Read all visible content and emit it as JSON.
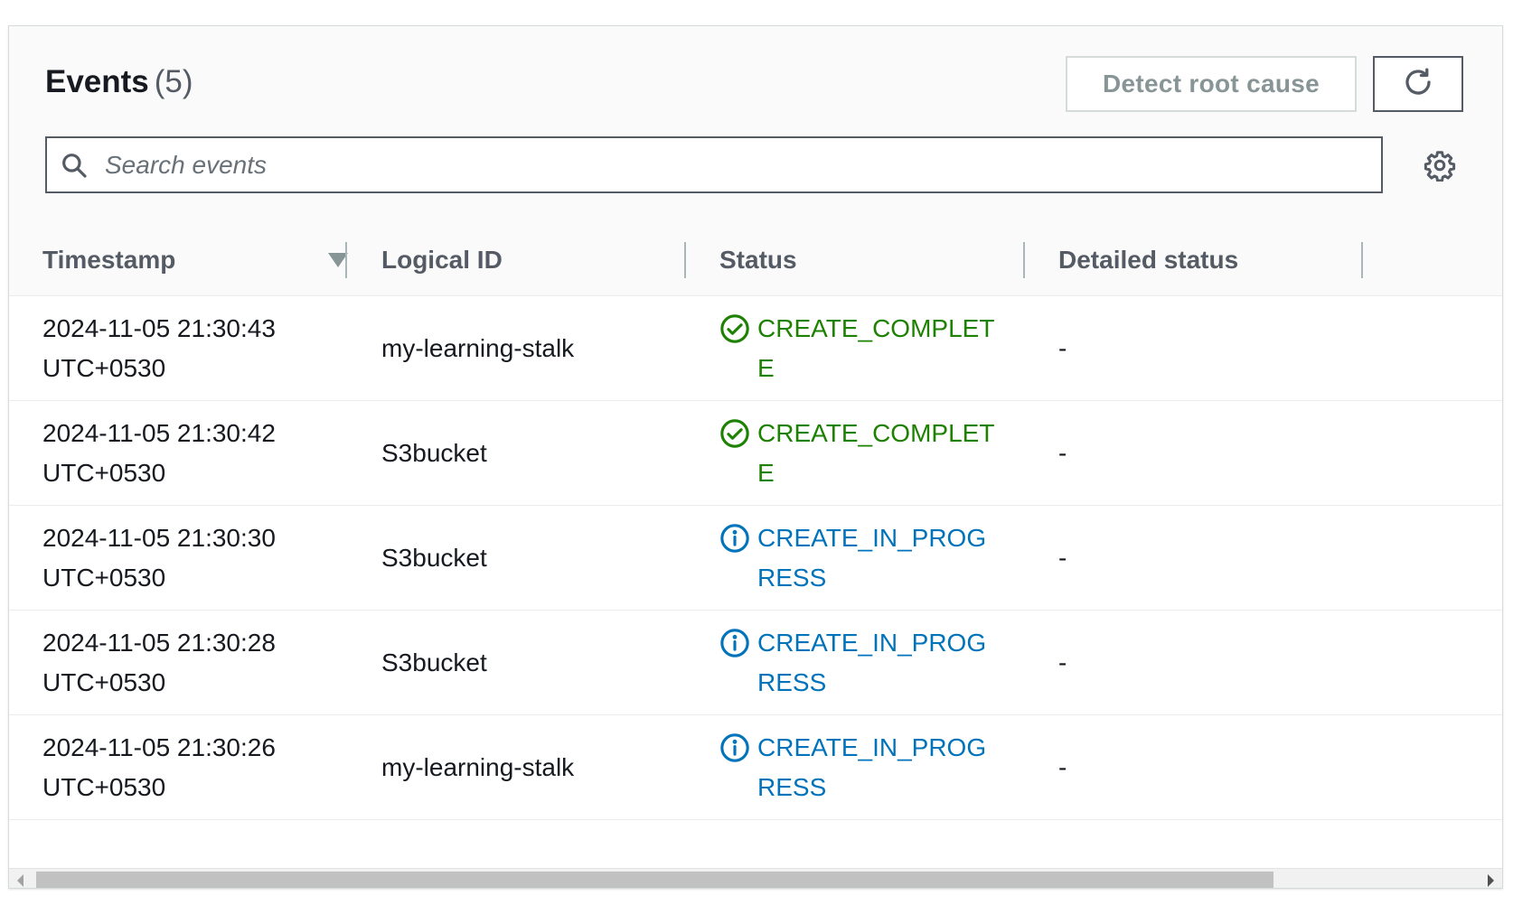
{
  "panel": {
    "title": "Events",
    "count": "(5)",
    "detect_button_label": "Detect root cause",
    "refresh_icon": "refresh-icon",
    "search_placeholder": "Search events",
    "search_icon": "search-icon",
    "settings_icon": "gear-icon"
  },
  "table": {
    "columns": [
      {
        "label": "Timestamp",
        "sort": "descending"
      },
      {
        "label": "Logical ID"
      },
      {
        "label": "Status"
      },
      {
        "label": "Detailed status"
      }
    ],
    "rows": [
      {
        "timestamp": "2024-11-05 21:30:43",
        "tz": "UTC+0530",
        "logical_id": "my-learning-stalk",
        "status": "CREATE_COMPLETE",
        "status_type": "success",
        "detailed_status": "-"
      },
      {
        "timestamp": "2024-11-05 21:30:42",
        "tz": "UTC+0530",
        "logical_id": "S3bucket",
        "status": "CREATE_COMPLETE",
        "status_type": "success",
        "detailed_status": "-"
      },
      {
        "timestamp": "2024-11-05 21:30:30",
        "tz": "UTC+0530",
        "logical_id": "S3bucket",
        "status": "CREATE_IN_PROGRESS",
        "status_type": "info",
        "detailed_status": "-"
      },
      {
        "timestamp": "2024-11-05 21:30:28",
        "tz": "UTC+0530",
        "logical_id": "S3bucket",
        "status": "CREATE_IN_PROGRESS",
        "status_type": "info",
        "detailed_status": "-"
      },
      {
        "timestamp": "2024-11-05 21:30:26",
        "tz": "UTC+0530",
        "logical_id": "my-learning-stalk",
        "status": "CREATE_IN_PROGRESS",
        "status_type": "info",
        "detailed_status": "-"
      }
    ]
  },
  "colors": {
    "success": "#1d8102",
    "info": "#0073bb",
    "heading": "#545b64",
    "text": "#16191f"
  },
  "horizontal_scroll": {
    "visible_fraction": 0.86,
    "position_fraction": 0.0
  }
}
